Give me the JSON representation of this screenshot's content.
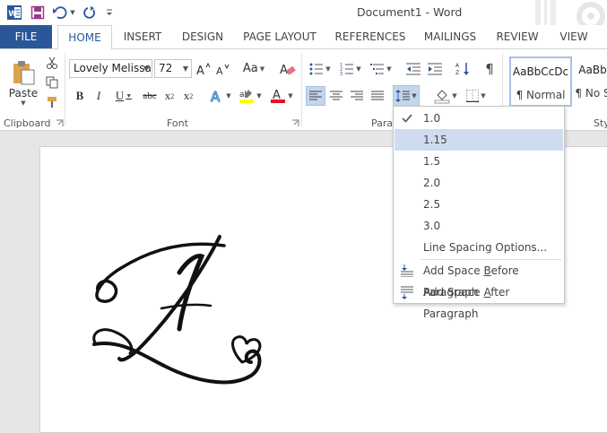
{
  "window": {
    "title": "Document1 - Word"
  },
  "tabs": [
    {
      "label": "FILE"
    },
    {
      "label": "HOME"
    },
    {
      "label": "INSERT"
    },
    {
      "label": "DESIGN"
    },
    {
      "label": "PAGE LAYOUT"
    },
    {
      "label": "REFERENCES"
    },
    {
      "label": "MAILINGS"
    },
    {
      "label": "REVIEW"
    },
    {
      "label": "VIEW"
    }
  ],
  "ribbon": {
    "clipboard": {
      "paste_label": "Paste",
      "group_label": "Clipboard"
    },
    "font": {
      "font_name": "Lovely Melissa",
      "font_size": "72",
      "change_case": "Aa",
      "group_label": "Font"
    },
    "paragraph": {
      "group_label": "Paragraph"
    },
    "styles": {
      "cards": [
        {
          "preview": "AaBbCcDc",
          "name": "¶ Normal"
        },
        {
          "preview": "AaBb",
          "name": "¶ No S"
        }
      ],
      "group_label": "Sty"
    }
  },
  "document": {
    "content": "A"
  },
  "line_spacing_menu": {
    "items": [
      {
        "label": "1.0",
        "checked": true
      },
      {
        "label": "1.15",
        "highlighted": true
      },
      {
        "label": "1.5"
      },
      {
        "label": "2.0"
      },
      {
        "label": "2.5"
      },
      {
        "label": "3.0"
      }
    ],
    "options_label": "Line Spacing Options...",
    "add_before": {
      "pre": "Add Space ",
      "key": "B",
      "post": "efore Paragraph"
    },
    "add_after": {
      "pre": "Add Space ",
      "key": "A",
      "post": "fter Paragraph"
    }
  },
  "colors": {
    "accent": "#2b579a",
    "highlight": "#cfdcef",
    "text": "#444444"
  }
}
